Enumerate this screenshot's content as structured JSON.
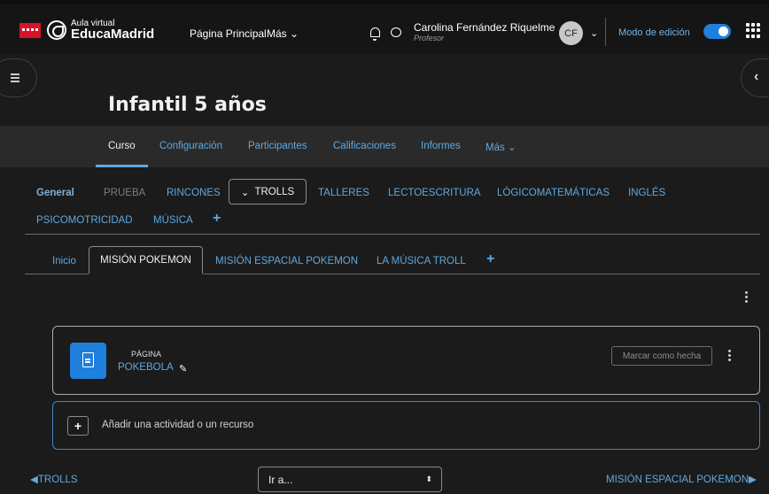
{
  "header": {
    "logo_top": "Aula virtual",
    "logo_bottom": "EducaMadrid",
    "nav_home": "Página Principal",
    "nav_more": "Más",
    "user_name": "Carolina Fernández Riquelme",
    "user_role": "Profesor",
    "avatar_initials": "CF",
    "edit_mode_label": "Modo de edición",
    "edit_mode_on": true
  },
  "page": {
    "title": "Infantil 5 años"
  },
  "secondary_nav": {
    "items": [
      "Curso",
      "Configuración",
      "Participantes",
      "Calificaciones",
      "Informes",
      "Más"
    ],
    "active": "Curso"
  },
  "section_tabs": {
    "general": "General",
    "prueba": "PRUEBA",
    "rincones": "RINCONES",
    "trolls": "TROLLS",
    "talleres": "TALLERES",
    "lectoescritura": "LECTOESCRITURA",
    "logicomatematicas": "LÓGICOMATEMÁTICAS",
    "ingles": "INGLÉS",
    "psicomotricidad": "PSICOMOTRICIDAD",
    "musica": "MÚSICA"
  },
  "sub_tabs": {
    "inicio": "Inicio",
    "mision_pokemon": "MISIÓN POKEMON",
    "mision_espacial": "MISIÓN ESPACIAL POKEMON",
    "musica_troll": "LA MÚSICA TROLL"
  },
  "activity": {
    "type": "PÁGINA",
    "name": "POKEBOLA",
    "mark_done": "Marcar como hecha"
  },
  "add_activity": {
    "label": "Añadir una actividad o un recurso"
  },
  "footer_nav": {
    "prev": "TROLLS",
    "next": "MISIÓN ESPACIAL POKEMON",
    "jump_value": "Ir a..."
  },
  "colors": {
    "accent": "#5fa9e0",
    "toggle": "#1f7fdc",
    "brand_red": "#d7132a"
  }
}
